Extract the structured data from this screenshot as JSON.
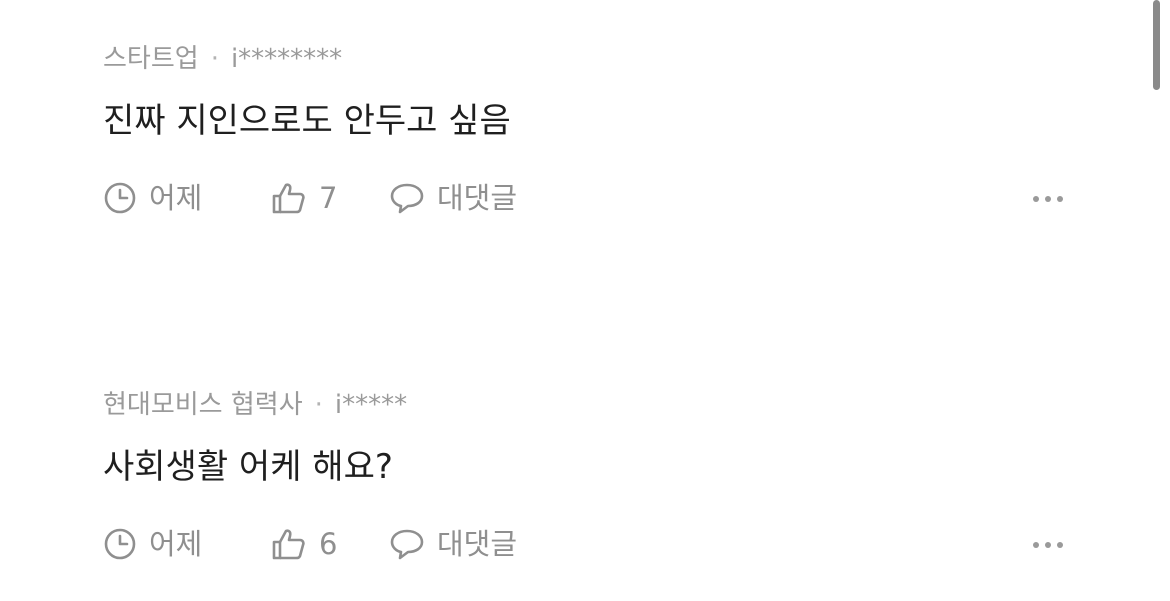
{
  "comments": [
    {
      "company": "스타트업",
      "separator": "·",
      "author": "i********",
      "text": "진짜 지인으로도 안두고 싶음",
      "time": "어제",
      "likes": "7",
      "reply_label": "대댓글"
    },
    {
      "company": "현대모비스 협력사",
      "separator": "·",
      "author": "i*****",
      "text": "사회생활 어케 해요?",
      "time": "어제",
      "likes": "6",
      "reply_label": "대댓글"
    }
  ],
  "icons": {
    "time": "clock-icon",
    "like": "thumbs-up-icon",
    "reply": "speech-bubble-icon",
    "more": "more-dots-icon"
  },
  "colors": {
    "meta_text": "#9a9a9a",
    "body_text": "#1f1f1f",
    "action_text": "#8f8f8f",
    "scrollbar": "#8a8a8a"
  }
}
